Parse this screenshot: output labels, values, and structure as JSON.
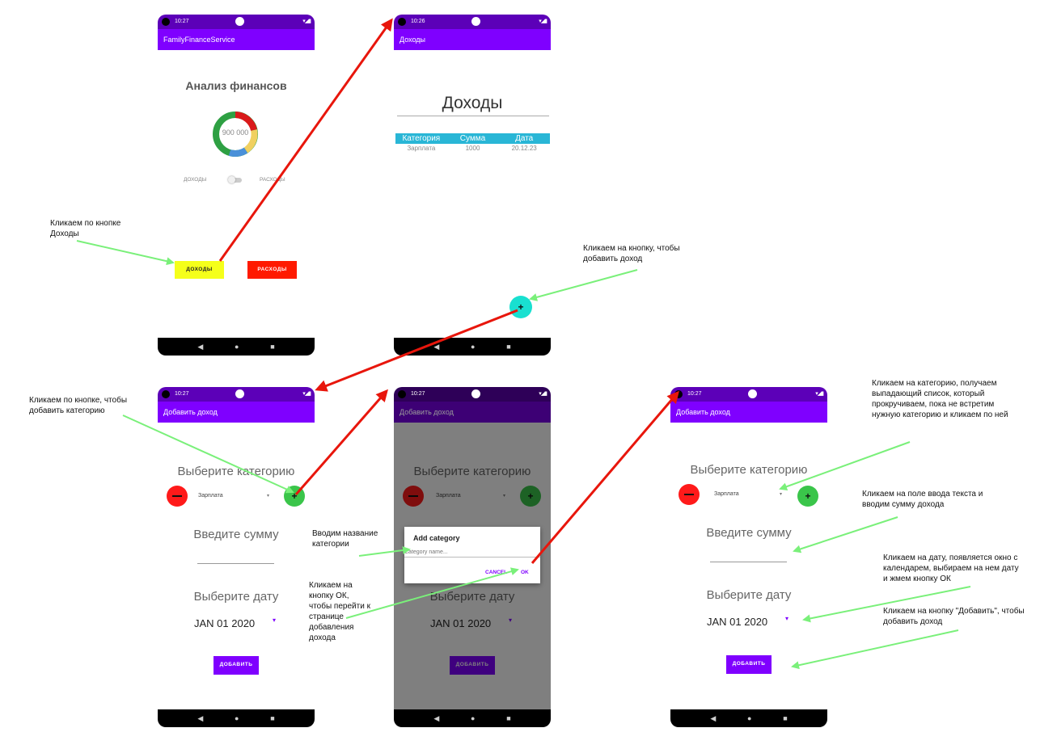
{
  "status_time": [
    "10:27",
    "10:26",
    "10:27",
    "10:27",
    "10:27"
  ],
  "screen1": {
    "app_title": "FamilyFinanceService",
    "heading": "Анализ финансов",
    "donut_center": "900 000",
    "toggle_left": "ДОХОДЫ",
    "toggle_right": "РАСХОДЫ",
    "income_button": "ДОХОДЫ",
    "expense_button": "РАСХОДЫ"
  },
  "screen2": {
    "app_title": "Доходы",
    "heading": "Доходы",
    "table_headers": [
      "Категория",
      "Сумма",
      "Дата"
    ],
    "table_rows": [
      [
        "Зарплата",
        "1000",
        "20.12.23"
      ]
    ],
    "fab_label": "+"
  },
  "add_screen": {
    "app_title": "Добавить доход",
    "choose_category": "Выберите категорию",
    "selected_category": "Зарплата",
    "enter_sum": "Введите сумму",
    "choose_date": "Выберите дату",
    "date_value": "JAN 01 2020",
    "add_button": "ДОБАВИТЬ"
  },
  "dialog": {
    "title": "Add category",
    "placeholder": "Category name...",
    "cancel": "CANCEL",
    "ok": "OK"
  },
  "annotations": {
    "click_income": "Кликаем по кнопке Доходы",
    "click_add_income": "Кликаем на кнопку, чтобы добавить доход",
    "click_add_category": "Кликаем по кнопке, чтобы добавить категорию",
    "enter_category_name": "Вводим название категории",
    "click_ok": "Кликаем на кнопку ОК, чтобы перейти к странице добавления дохода",
    "click_category": "Кликаем на категорию, получаем выпадающий список, который прокручиваем, пока не встретим нужную категорию и кликаем по ней",
    "click_sum_field": "Кликаем на поле ввода текста и вводим сумму дохода",
    "click_date": "Кликаем на дату, появляется окно с календарем, выбираем на нем дату и жмем кнопку ОК",
    "click_add": "Кликаем на кнопку \"Добавить\", чтобы добавить доход"
  },
  "colors": {
    "app_bar": "#7f00ff",
    "income_button": "#f5ff1a",
    "expense_button": "#ff1a00",
    "fab": "#19e0d0",
    "remove_button": "#ff1a1a",
    "add_category_button": "#3ac54a",
    "arrow_red": "#e8160c",
    "arrow_green": "#7af07a"
  }
}
